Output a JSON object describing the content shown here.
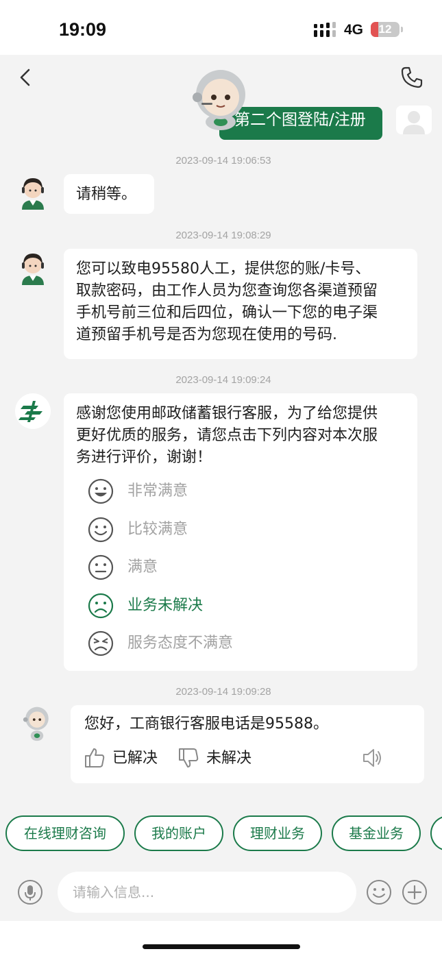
{
  "status_bar": {
    "time": "19:09",
    "network": "4G",
    "battery": "12"
  },
  "colors": {
    "brand_green": "#1b7a4a",
    "background": "#f3f3f3",
    "bubble": "#ffffff",
    "muted_text": "#a2a2a2"
  },
  "header": {
    "back_icon": "chevron-left-icon",
    "call_icon": "phone-icon"
  },
  "user_message": {
    "text": "第二个图登陆/注册"
  },
  "messages": [
    {
      "timestamp": "2023-09-14 19:06:53",
      "sender": "agent",
      "text": "请稍等。"
    },
    {
      "timestamp": "2023-09-14 19:08:29",
      "sender": "agent",
      "lines": [
        "您可以致电95580人工，提供您的账/卡号、",
        "取款密码，由工作人员为您查询您各渠道预留",
        "手机号前三位和后四位，确认一下您的电子渠",
        "道预留手机号是否为您现在使用的号码."
      ]
    },
    {
      "timestamp": "2023-09-14 19:09:24",
      "sender": "system",
      "lines": [
        "感谢您使用邮政储蓄银行客服，为了给您提供",
        "更好优质的服务，请您点击下列内容对本次服",
        "务进行评价，谢谢！"
      ],
      "ratings": [
        {
          "label": "非常满意",
          "icon": "grin-face-icon",
          "selected": false
        },
        {
          "label": "比较满意",
          "icon": "smile-face-icon",
          "selected": false
        },
        {
          "label": "满意",
          "icon": "neutral-face-icon",
          "selected": false
        },
        {
          "label": "业务未解决",
          "icon": "sad-face-icon",
          "selected": true
        },
        {
          "label": "服务态度不满意",
          "icon": "angry-face-icon",
          "selected": false
        }
      ]
    },
    {
      "timestamp": "2023-09-14 19:09:28",
      "sender": "bot",
      "text": "您好，工商银行客服电话是95588。",
      "feedback": {
        "resolved": "已解决",
        "unresolved": "未解决",
        "speaker_icon": "speaker-icon"
      }
    }
  ],
  "quick_replies": [
    "在线理财咨询",
    "我的账户",
    "理财业务",
    "基金业务"
  ],
  "input": {
    "placeholder": "请输入信息..."
  }
}
